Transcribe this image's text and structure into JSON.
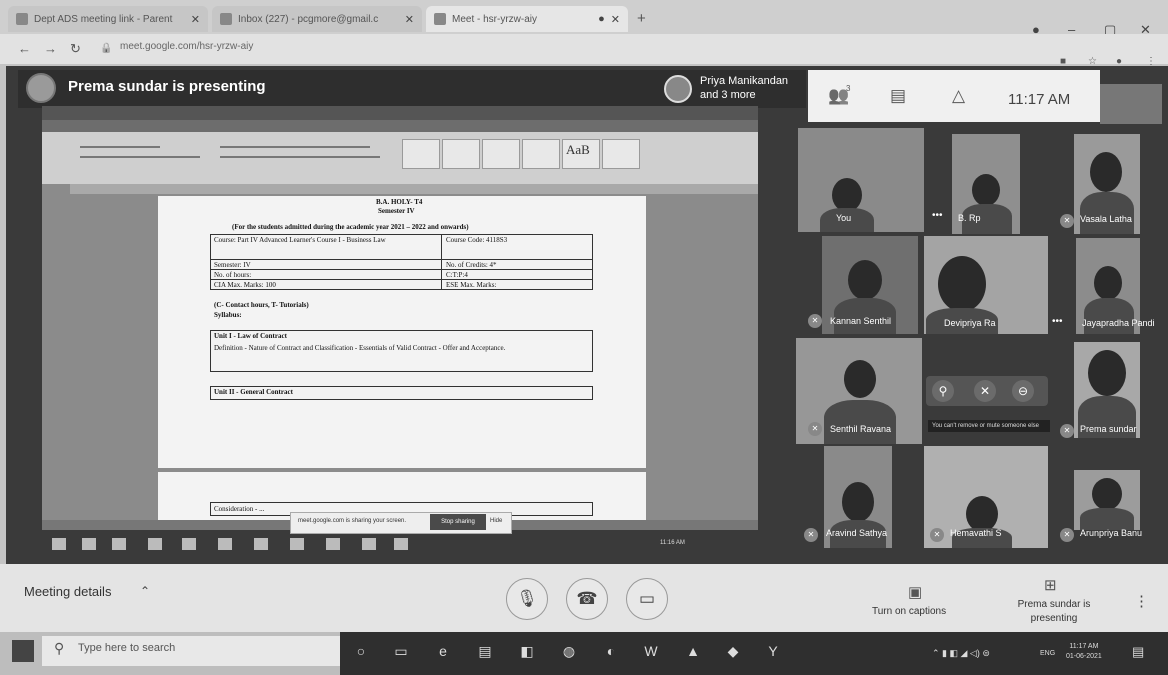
{
  "browser": {
    "tabs": [
      {
        "label": "Dept ADS meeting link - Parent",
        "active": false
      },
      {
        "label": "Inbox (227) - pcgmore@gmail.c",
        "active": false
      },
      {
        "label": "Meet - hsr-yrzw-aiy",
        "active": true
      }
    ],
    "url": "meet.google.com/hsr-yrzw-aiy"
  },
  "meet": {
    "presenting_banner": "Prema sundar is presenting",
    "other_presenters": "Priya Manikandan and 3 more",
    "participants_count": "3",
    "clock": "11:17 AM"
  },
  "shared_doc": {
    "header_code": "B.A. HOLY- T4",
    "semester": "Semester IV",
    "admitted": "(For the students admitted during the academic year 2021 – 2022 and onwards)",
    "rows": [
      [
        "Course: Part IV Advanced Learner's Course I - Business Law",
        "Course Code: 4118S3"
      ],
      [
        "Semester: IV",
        "No. of Credits: 4*"
      ],
      [
        "No. of hours: ",
        "C:T:P:4"
      ],
      [
        "CIA Max. Marks: 100",
        "ESE Max. Marks:"
      ]
    ],
    "ctp_note": "(C- Contact hours, T- Tutorials)",
    "syllabus": "Syllabus:",
    "unit1_title": "Unit I - Law of Contract",
    "unit1_body": "Definition - Nature of Contract and Classification - Essentials of Valid Contract - Offer and Acceptance.",
    "unit2_title": "Unit II - General Contract",
    "unit3_title": "Consideration - ...",
    "toast_text": "meet.google.com is sharing your screen.",
    "toast_stop": "Stop sharing",
    "toast_hide": "Hide",
    "inner_clock": "11:16 AM"
  },
  "participants": [
    {
      "name": "You"
    },
    {
      "name": "B. Rp"
    },
    {
      "name": "Vasala Latha"
    },
    {
      "name": "Kannan Senthil"
    },
    {
      "name": "Devipriya Ra"
    },
    {
      "name": "Jayapradha Pandi"
    },
    {
      "name": "Senthil Ravana"
    },
    {
      "name": "Prema sundar"
    },
    {
      "name": "Aravind Sathya"
    },
    {
      "name": "Hemavathi S"
    },
    {
      "name": "Arunpriya Banu"
    }
  ],
  "tile_hint": "You can't remove or mute someone else",
  "bottom": {
    "meeting_details": "Meeting details",
    "captions": "Turn on captions",
    "presenting": "Prema sundar is presenting"
  },
  "taskbar": {
    "search_placeholder": "Type here to search",
    "lang": "ENG",
    "time": "11:17 AM",
    "date": "01-06-2021"
  }
}
